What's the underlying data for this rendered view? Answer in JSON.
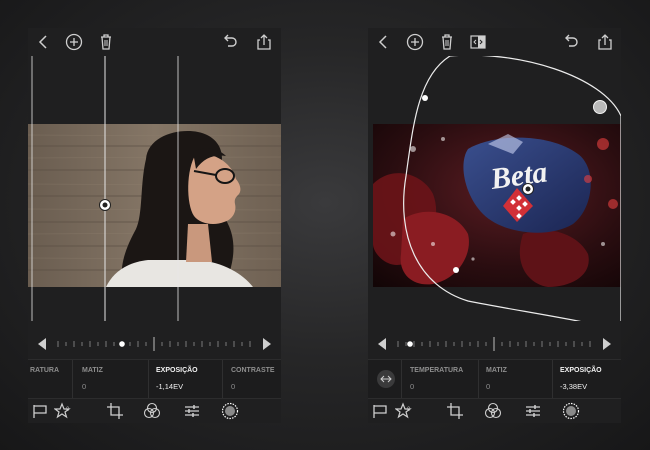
{
  "left": {
    "sliders": [
      {
        "label": "RATURA",
        "value": ""
      },
      {
        "label": "MATIZ",
        "value": "0"
      },
      {
        "label": "EXPOSIÇÃO",
        "value": "-1,14EV"
      },
      {
        "label": "CONTRASTE",
        "value": "0"
      }
    ],
    "active": 2
  },
  "right": {
    "sliders": [
      {
        "label": "TEMPERATURA",
        "value": "0"
      },
      {
        "label": "MATIZ",
        "value": "0"
      },
      {
        "label": "EXPOSIÇÃO",
        "value": "-3,38EV"
      }
    ],
    "active": 2
  },
  "icons": {
    "top": [
      "back-icon",
      "add-icon",
      "trash-icon",
      "compare-icon",
      "undo-icon",
      "share-icon"
    ],
    "toolbar": [
      "flag-icon",
      "star-icon",
      "crop-icon",
      "color-icon",
      "sliders-icon",
      "selection-icon"
    ],
    "star_count": "0"
  }
}
